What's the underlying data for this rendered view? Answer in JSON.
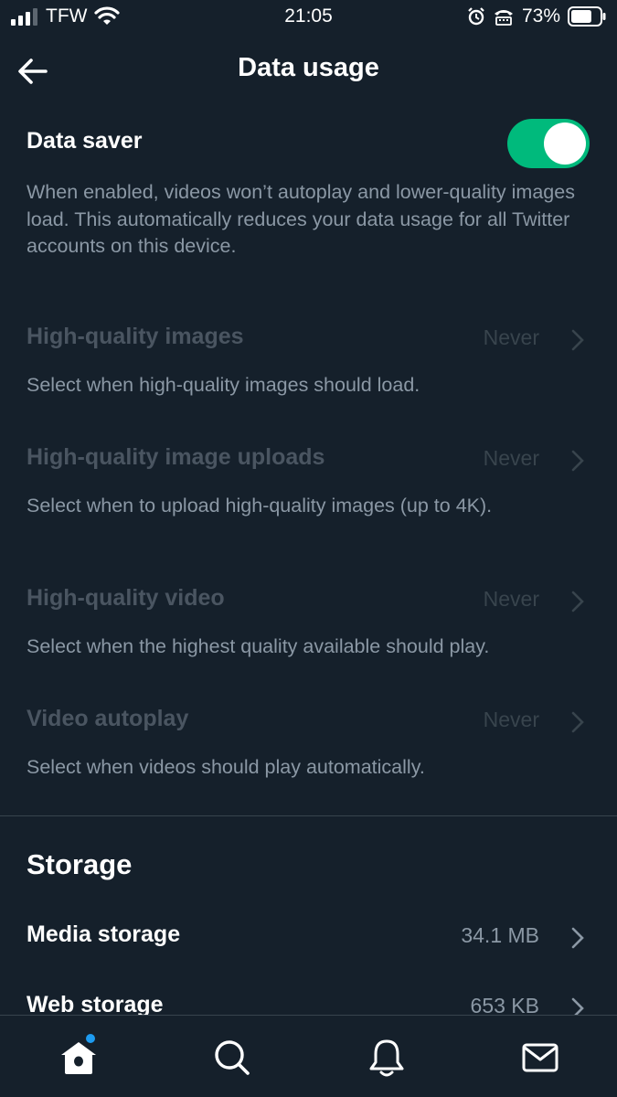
{
  "status_bar": {
    "carrier": "TFW",
    "time": "21:05",
    "battery_percent": "73%",
    "battery_level": 0.73,
    "icons": [
      "signal-icon",
      "wifi-icon",
      "alarm-icon",
      "tty-icon",
      "battery-icon"
    ]
  },
  "header": {
    "title": "Data usage",
    "back_icon": "back-arrow-icon"
  },
  "data_saver": {
    "label": "Data saver",
    "enabled": true,
    "description": "When enabled, videos won’t autoplay and lower-quality images load. This automatically reduces your data usage for all Twitter accounts on this device."
  },
  "settings": [
    {
      "label": "High-quality images",
      "value": "Never",
      "description": "Select when high-quality images should load."
    },
    {
      "label": "High-quality image uploads",
      "value": "Never",
      "description": "Select when to upload high-quality images (up to 4K)."
    },
    {
      "label": "High-quality video",
      "value": "Never",
      "description": "Select when the highest quality available should play."
    },
    {
      "label": "Video autoplay",
      "value": "Never",
      "description": "Select when videos should play automatically."
    }
  ],
  "storage": {
    "title": "Storage",
    "items": [
      {
        "label": "Media storage",
        "value": "34.1 MB"
      },
      {
        "label": "Web storage",
        "value": "653 KB"
      }
    ]
  },
  "tab_bar": {
    "tabs": [
      "home-icon",
      "search-icon",
      "notifications-icon",
      "messages-icon"
    ],
    "home_badge": true
  },
  "colors": {
    "background": "#15202b",
    "toggle_on": "#00ba7c",
    "accent": "#1d9bf0",
    "secondary_text": "#8b98a5",
    "disabled_text": "#4a5561"
  }
}
